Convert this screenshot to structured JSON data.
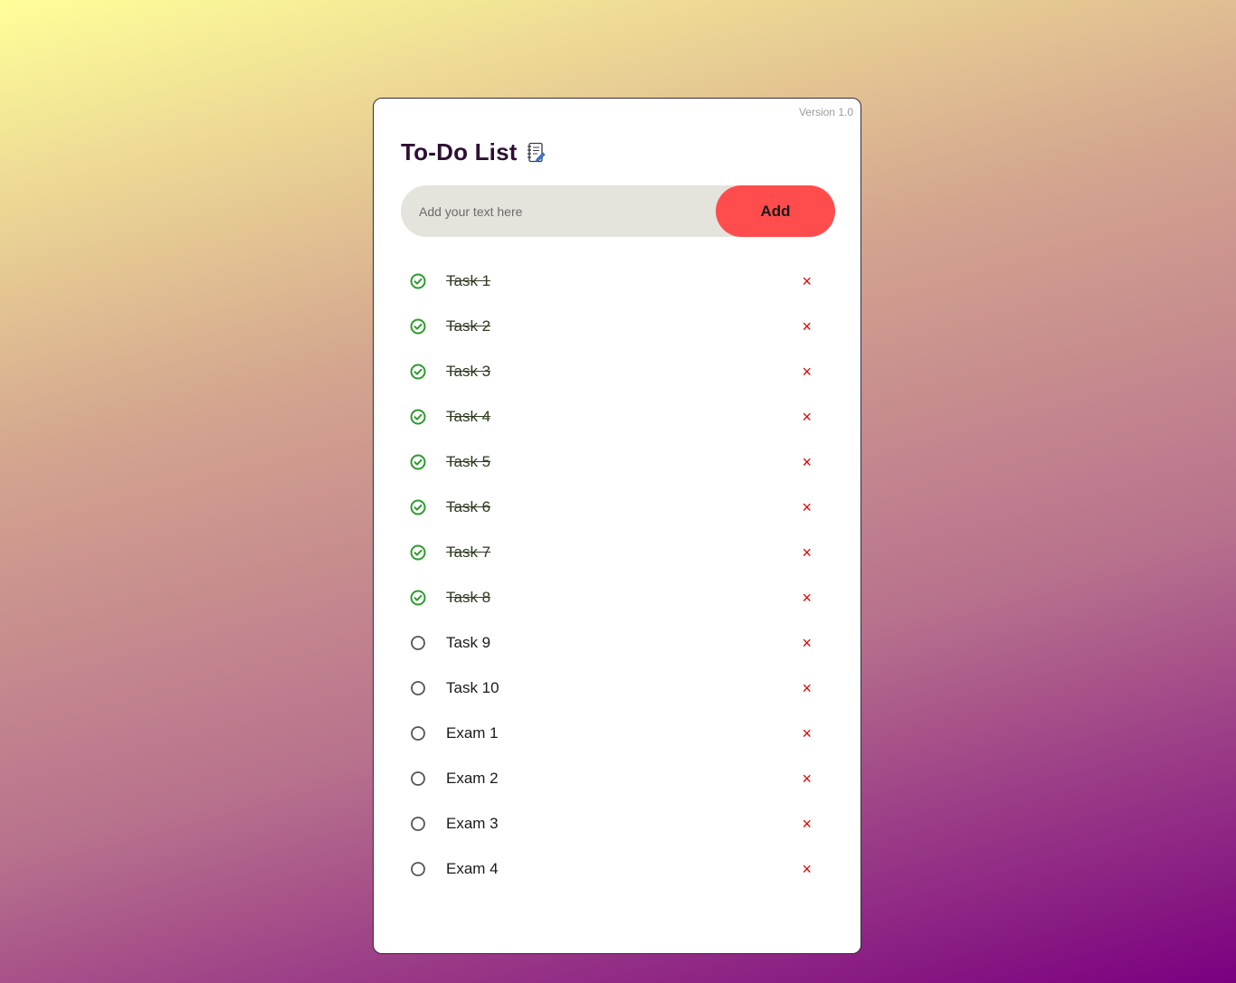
{
  "app": {
    "version": "Version 1.0",
    "title": "To-Do List",
    "title_icon": "notebook-icon"
  },
  "input": {
    "placeholder": "Add your text here",
    "value": "",
    "add_label": "Add"
  },
  "colors": {
    "accent": "#ff4d4d",
    "done": "#2e9a2e",
    "delete": "#e60000",
    "title": "#2e0f33"
  },
  "tasks": [
    {
      "text": "Task 1",
      "done": true,
      "delete": "×"
    },
    {
      "text": "Task 2",
      "done": true,
      "delete": "×"
    },
    {
      "text": "Task 3",
      "done": true,
      "delete": "×"
    },
    {
      "text": "Task 4",
      "done": true,
      "delete": "×"
    },
    {
      "text": "Task 5",
      "done": true,
      "delete": "×"
    },
    {
      "text": "Task 6",
      "done": true,
      "delete": "×"
    },
    {
      "text": "Task 7",
      "done": true,
      "delete": "×"
    },
    {
      "text": "Task 8",
      "done": true,
      "delete": "×"
    },
    {
      "text": "Task 9",
      "done": false,
      "delete": "×"
    },
    {
      "text": "Task 10",
      "done": false,
      "delete": "×"
    },
    {
      "text": "Exam 1",
      "done": false,
      "delete": "×"
    },
    {
      "text": "Exam 2",
      "done": false,
      "delete": "×"
    },
    {
      "text": "Exam 3",
      "done": false,
      "delete": "×"
    },
    {
      "text": "Exam 4",
      "done": false,
      "delete": "×"
    }
  ]
}
